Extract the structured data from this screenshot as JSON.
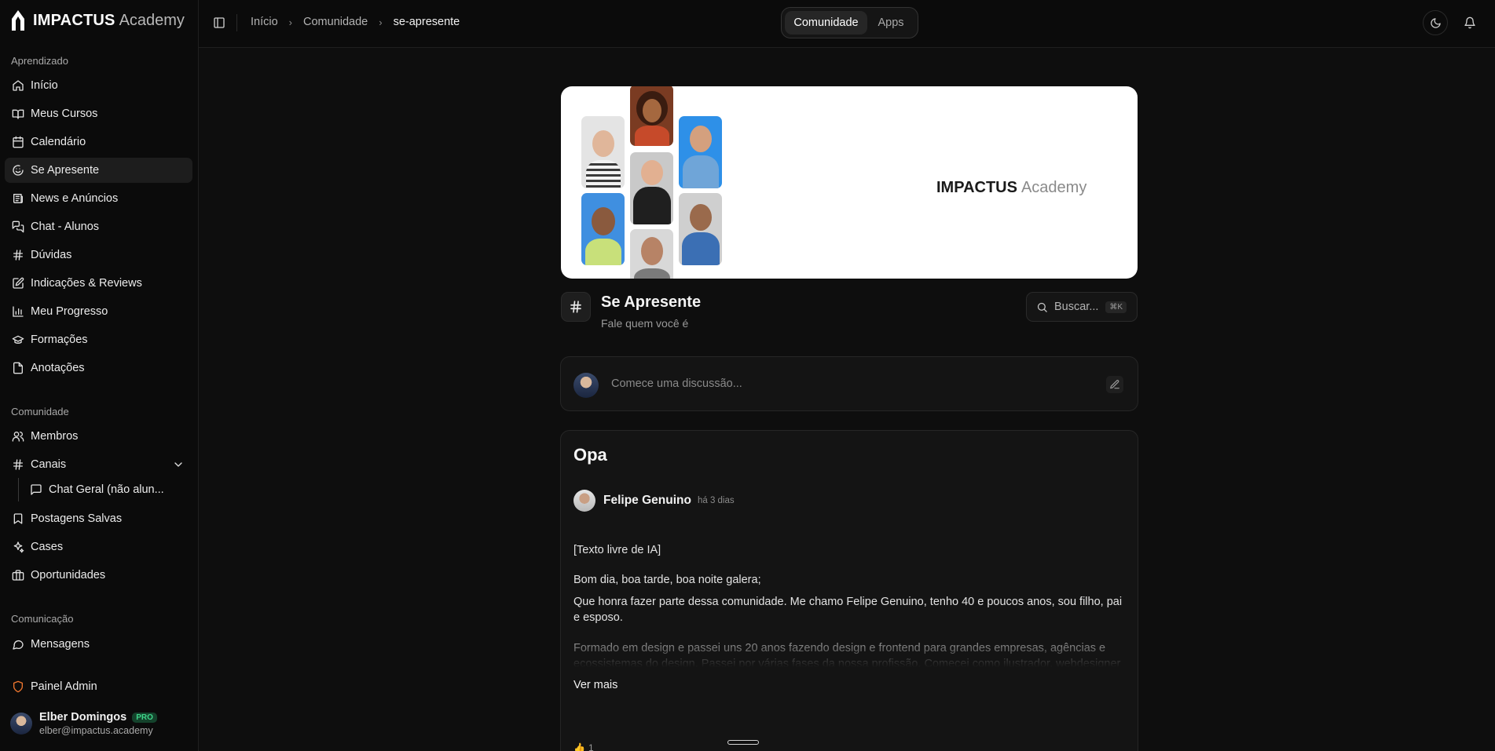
{
  "brand": {
    "name_strong": "IMPACTUS",
    "name_light": "Academy"
  },
  "sidebar": {
    "sections": [
      {
        "label": "Aprendizado"
      },
      {
        "label": "Comunidade"
      },
      {
        "label": "Comunicação"
      }
    ],
    "items": [
      {
        "label": "Início",
        "icon": "home-icon"
      },
      {
        "label": "Meus Cursos",
        "icon": "book-icon"
      },
      {
        "label": "Calendário",
        "icon": "calendar-icon"
      },
      {
        "label": "Se Apresente",
        "icon": "wave-icon",
        "active": true
      },
      {
        "label": "News e Anúncios",
        "icon": "newspaper-icon"
      },
      {
        "label": "Chat - Alunos",
        "icon": "chat-icon"
      },
      {
        "label": "Dúvidas",
        "icon": "hash-icon"
      },
      {
        "label": "Indicações & Reviews",
        "icon": "review-icon"
      },
      {
        "label": "Meu Progresso",
        "icon": "chart-icon"
      },
      {
        "label": "Formações",
        "icon": "graduation-icon"
      },
      {
        "label": "Anotações",
        "icon": "note-icon"
      },
      {
        "label": "Membros",
        "icon": "users-icon"
      },
      {
        "label": "Canais",
        "icon": "hash-icon"
      },
      {
        "label": "Chat Geral (não alun...",
        "icon": "message-square-icon"
      },
      {
        "label": "Postagens Salvas",
        "icon": "bookmark-icon"
      },
      {
        "label": "Cases",
        "icon": "sparkles-icon"
      },
      {
        "label": "Oportunidades",
        "icon": "briefcase-icon"
      },
      {
        "label": "Mensagens",
        "icon": "message-circle-icon"
      },
      {
        "label": "Painel Admin",
        "icon": "shield-icon"
      }
    ],
    "user": {
      "name": "Elber Domingos",
      "badge": "PRO",
      "email": "elber@impactus.academy"
    }
  },
  "topbar": {
    "breadcrumb": [
      "Início",
      "Comunidade",
      "se-apresente"
    ],
    "tabs": [
      {
        "label": "Comunidade",
        "active": true
      },
      {
        "label": "Apps",
        "active": false
      }
    ]
  },
  "banner": {
    "logo_strong": "IMPACTUS",
    "logo_light": "Academy"
  },
  "channel": {
    "title": "Se Apresente",
    "subtitle": "Fale quem você é"
  },
  "search": {
    "placeholder": "Buscar...",
    "shortcut": "⌘K"
  },
  "composer": {
    "placeholder": "Comece uma discussão..."
  },
  "post": {
    "title": "Opa",
    "author": "Felipe Genuino",
    "time": "há 3 dias",
    "paragraphs": [
      "[Texto livre de IA]",
      "Bom dia, boa tarde, boa noite galera;",
      "Que honra fazer parte dessa comunidade. Me chamo Felipe Genuino, tenho 40 e poucos anos, sou filho, pai e esposo.",
      "Formado em design e passei uns 20 anos fazendo design e frontend para grandes empresas, agências e ecossistemas do design. Passei por várias fases da nossa profissão. Comecei como ilustrador, webdesigner"
    ],
    "see_more": "Ver mais",
    "reaction_count": "1"
  },
  "colors": {
    "accent_green": "#3fd48a",
    "admin_orange": "#f0772f"
  }
}
